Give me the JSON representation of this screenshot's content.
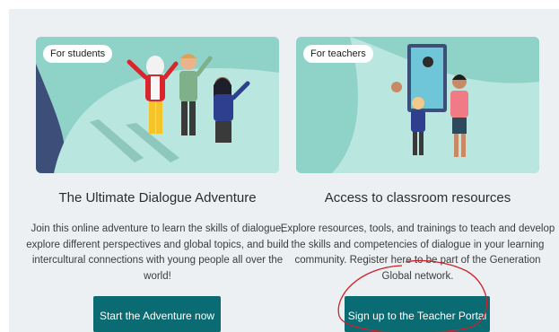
{
  "students": {
    "tag": "For students",
    "title": "The Ultimate Dialogue Adventure",
    "description": "Join this online adventure to learn the skills of dialogue, explore different perspectives and global topics, and build intercultural connections with young people all over the world!",
    "button": "Start the Adventure now"
  },
  "teachers": {
    "tag": "For teachers",
    "title": "Access to classroom resources",
    "description": "Explore resources, tools, and trainings to teach and develop the skills and competencies of dialogue in your learning community. Register here to be part of the Generation Global network.",
    "button": "Sign up to the Teacher Portal"
  },
  "colors": {
    "background_panel": "#ecf0f2",
    "button": "#0a6b72",
    "illustration_bg": "#8fd3c8",
    "annotation_circle": "#d0202a"
  }
}
